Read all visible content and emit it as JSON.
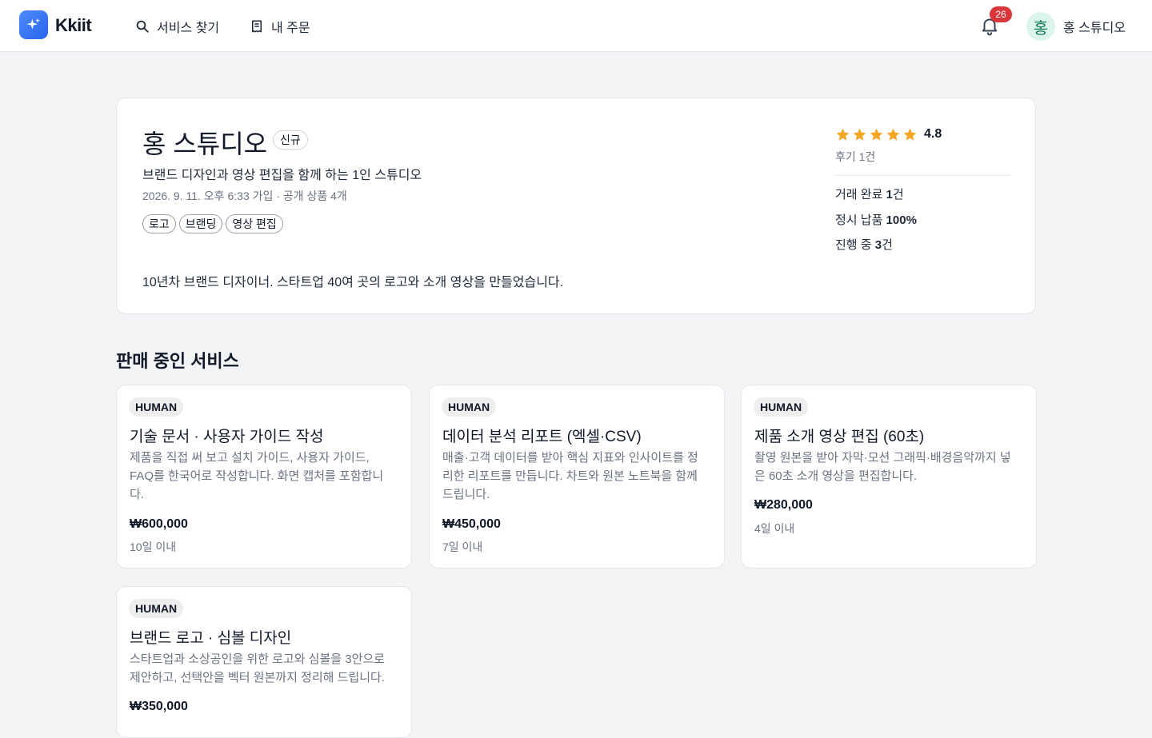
{
  "header": {
    "logo_text": "Kkiit",
    "nav": [
      {
        "label": "서비스 찾기",
        "icon": "search-icon"
      },
      {
        "label": "내 주문",
        "icon": "receipt-icon"
      }
    ],
    "notification_count": "26",
    "user": {
      "avatar_initial": "홍",
      "name": "홍 스튜디오"
    }
  },
  "profile": {
    "name": "홍 스튜디오",
    "badge": "신규",
    "tagline": "브랜드 디자인과 영상 편집을 함께 하는 1인 스튜디오",
    "meta": "2026. 9. 11. 오후 6:33 가입 · 공개 상품 4개",
    "tags": [
      "로고",
      "브랜딩",
      "영상 편집"
    ],
    "bio": "10년차 브랜드 디자이너. 스타트업 40여 곳의 로고와 소개 영상을 만들었습니다.",
    "rating": {
      "stars": 5,
      "value": "4.8",
      "reviews": "후기 1건"
    },
    "stats": [
      {
        "label": "거래 완료 ",
        "value": "1",
        "suffix": "건"
      },
      {
        "label": "정시 납품 ",
        "value": "100%",
        "suffix": ""
      },
      {
        "label": "진행 중 ",
        "value": "3",
        "suffix": "건"
      }
    ]
  },
  "services_section": {
    "title": "판매 중인 서비스",
    "items": [
      {
        "badge": "HUMAN",
        "title": "기술 문서 · 사용자 가이드 작성",
        "description": "제품을 직접 써 보고 설치 가이드, 사용자 가이드, FAQ를 한국어로 작성합니다. 화면 캡처를 포함합니다.",
        "price": "₩600,000",
        "delivery": "10일 이내"
      },
      {
        "badge": "HUMAN",
        "title": "데이터 분석 리포트 (엑셀·CSV)",
        "description": "매출·고객 데이터를 받아 핵심 지표와 인사이트를 정리한 리포트를 만듭니다. 차트와 원본 노트북을 함께 드립니다.",
        "price": "₩450,000",
        "delivery": "7일 이내"
      },
      {
        "badge": "HUMAN",
        "title": "제품 소개 영상 편집 (60초)",
        "description": "촬영 원본을 받아 자막·모션 그래픽·배경음악까지 넣은 60초 소개 영상을 편집합니다.",
        "price": "₩280,000",
        "delivery": "4일 이내"
      },
      {
        "badge": "HUMAN",
        "title": "브랜드 로고 · 심볼 디자인",
        "description": "스타트업과 소상공인을 위한 로고와 심볼을 3안으로 제안하고, 선택안을 벡터 원본까지 정리해 드립니다.",
        "price": "₩350,000",
        "delivery": ""
      }
    ]
  },
  "colors": {
    "accent": "#2563eb",
    "badge_red": "#d9373c",
    "star": "#f5a623",
    "avatar_bg": "#dcf5ea"
  }
}
